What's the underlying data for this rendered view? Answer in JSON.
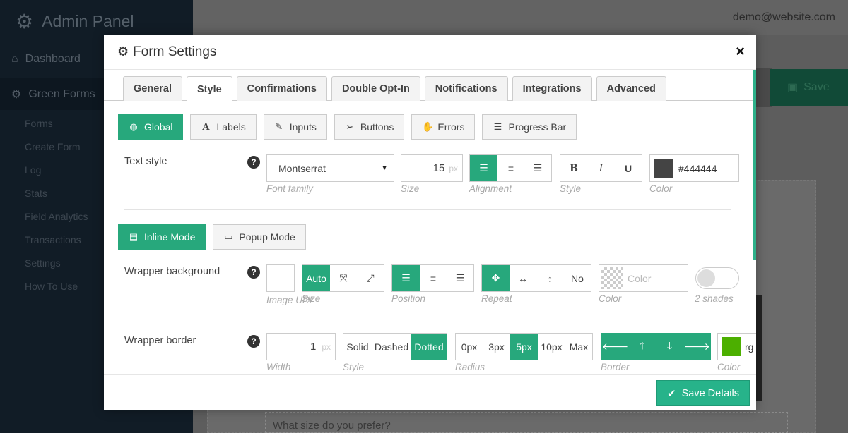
{
  "app": {
    "brand": "Admin Panel",
    "user_email": "demo@website.com",
    "nav_dashboard": "Dashboard",
    "nav_green_forms": "Green Forms",
    "subnav": [
      "Forms",
      "Create Form",
      "Log",
      "Stats",
      "Field Analytics",
      "Transactions",
      "Settings",
      "How To Use"
    ],
    "save_label": "Save",
    "question_text": "What size do you prefer?"
  },
  "modal": {
    "title": "Form Settings",
    "close": "×",
    "tabs": [
      "General",
      "Style",
      "Confirmations",
      "Double Opt-In",
      "Notifications",
      "Integrations",
      "Advanced"
    ],
    "active_tab": "Style",
    "style_subtabs": [
      "Global",
      "Labels",
      "Inputs",
      "Buttons",
      "Errors",
      "Progress Bar"
    ],
    "text_style": {
      "label": "Text style",
      "font_family": "Montserrat",
      "font_family_caption": "Font family",
      "size": "15",
      "size_unit": "px",
      "size_caption": "Size",
      "alignment_caption": "Alignment",
      "style_caption": "Style",
      "color": "#444444",
      "color_caption": "Color",
      "bold": "B",
      "italic": "I",
      "underline": "U"
    },
    "modes": [
      "Inline Mode",
      "Popup Mode"
    ],
    "wrapper_background": {
      "label": "Wrapper background",
      "image_caption": "Image URL",
      "size_caption": "Size",
      "size_auto": "Auto",
      "position_caption": "Position",
      "repeat_caption": "Repeat",
      "repeat_no": "No",
      "color_placeholder": "Color",
      "color_caption": "Color",
      "shades_caption": "2 shades"
    },
    "wrapper_border": {
      "label": "Wrapper border",
      "width": "1",
      "width_unit": "px",
      "width_caption": "Width",
      "styles": [
        "Solid",
        "Dashed",
        "Dotted"
      ],
      "style_caption": "Style",
      "radii": [
        "0px",
        "3px",
        "5px",
        "10px",
        "Max"
      ],
      "radius_caption": "Radius",
      "border_caption": "Border",
      "color_text": "rg",
      "color_caption": "Color"
    },
    "save_details": "Save Details"
  },
  "colors": {
    "accent": "#27a87c",
    "text_color_swatch": "#444444",
    "border_color_swatch": "#4caf00"
  }
}
